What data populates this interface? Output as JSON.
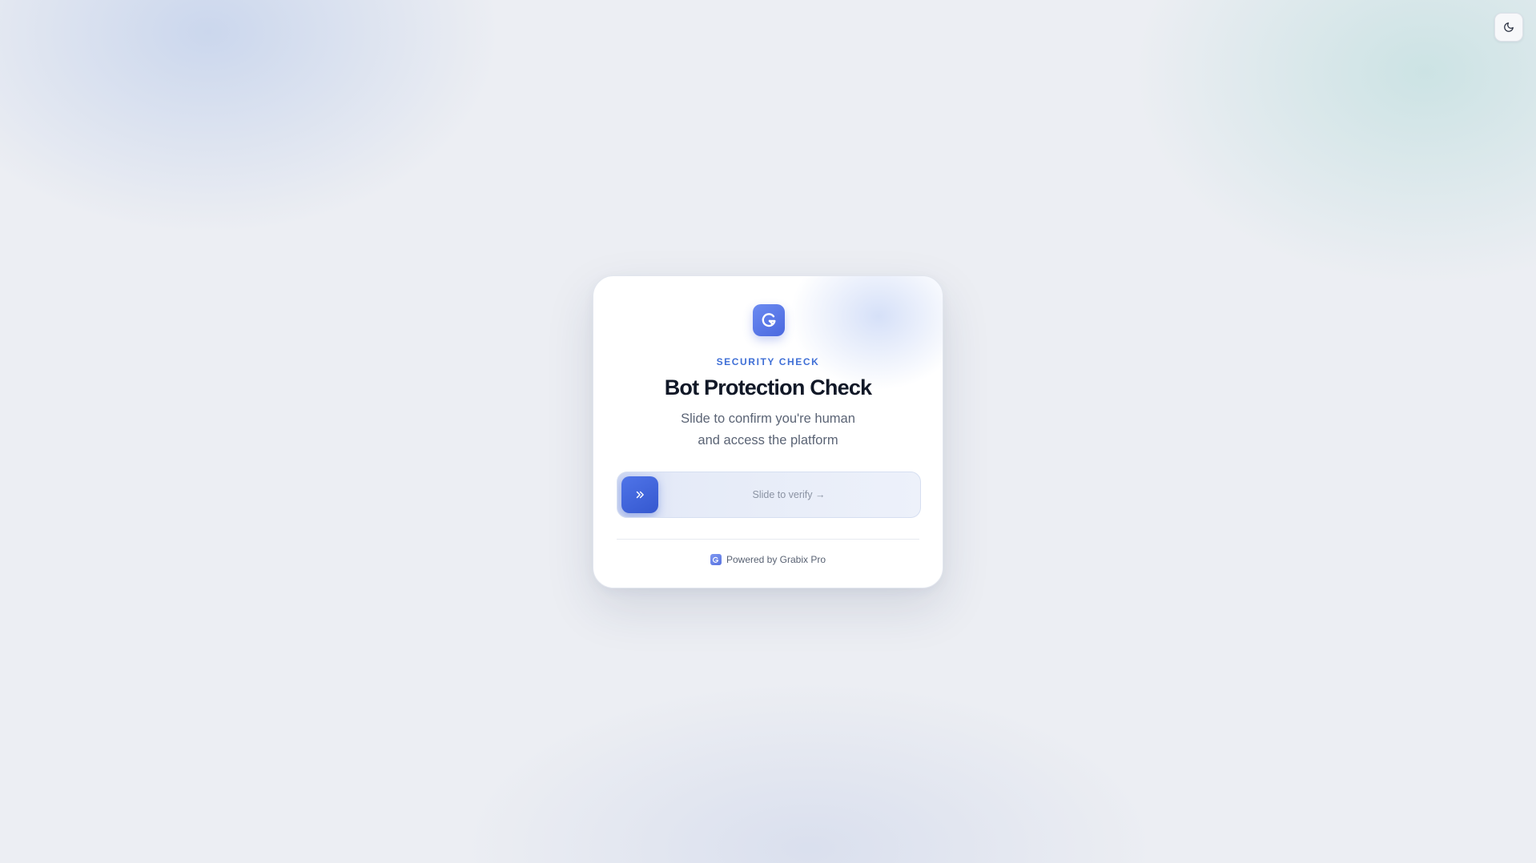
{
  "header": {
    "theme_toggle_icon": "moon-icon"
  },
  "card": {
    "logo_icon": "grabix-logo-icon",
    "eyebrow": "SECURITY CHECK",
    "title": "Bot Protection Check",
    "subtitle_line1": "Slide to confirm you're human",
    "subtitle_line2": "and access the platform"
  },
  "slider": {
    "handle_icon": "chevrons-right-icon",
    "label": "Slide to verify →",
    "progress": 0
  },
  "footer": {
    "logo_icon": "grabix-logo-icon",
    "text": "Powered by Grabix Pro"
  },
  "colors": {
    "accent": "#3f6fd6",
    "handle": "#3558cf",
    "title": "#111827",
    "background": "#eceef3"
  }
}
